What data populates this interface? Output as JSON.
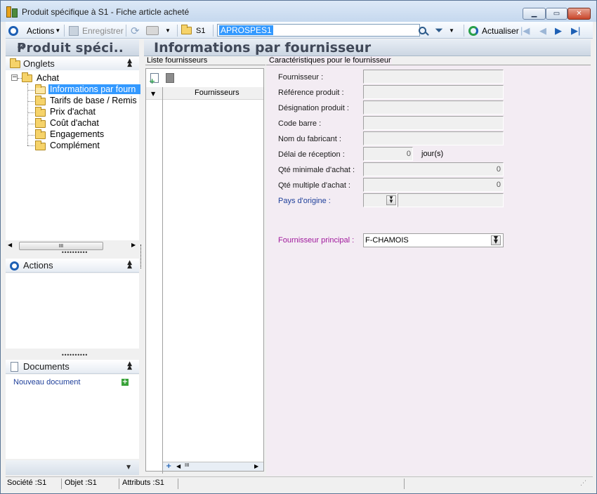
{
  "window": {
    "title": "Produit spécifique à S1 -  Fiche article acheté"
  },
  "toolbar": {
    "actions_label": "Actions",
    "save_label": "Enregistrer",
    "site_label": "S1",
    "record_value": "APROSPES1",
    "refresh_label": "Actualiser"
  },
  "left_panel": {
    "title": "Produit spéci..",
    "collapse_glyph": "«",
    "tabs_header": "Onglets",
    "tree_root": "Achat",
    "tree_items": [
      "Informations par fourn",
      "Tarifs de base / Remis",
      "Prix d'achat",
      "Coût d'achat",
      "Engagements",
      "Complément"
    ],
    "actions_header": "Actions",
    "documents_header": "Documents",
    "new_document_link": "Nouveau document"
  },
  "main": {
    "title": "Informations par fournisseur",
    "supplier_list_label": "Liste fournisseurs",
    "supplier_list_column": "Fournisseurs",
    "characteristics_label": "Caractéristiques pour le fournisseur",
    "fields": {
      "supplier_label": "Fournisseur :",
      "product_ref_label": "Référence produit :",
      "product_desc_label": "Désignation produit :",
      "barcode_label": "Code barre :",
      "manufacturer_label": "Nom du fabricant :",
      "delay_label": "Délai de réception :",
      "delay_value": "0",
      "delay_unit": "jour(s)",
      "min_qty_label": "Qté minimale d'achat :",
      "min_qty_value": "0",
      "multiple_qty_label": "Qté multiple d'achat :",
      "multiple_qty_value": "0",
      "origin_country_label": "Pays d'origine :",
      "main_supplier_label": "Fournisseur principal :",
      "main_supplier_value": "F-CHAMOIS"
    }
  },
  "statusbar": {
    "company": "Société :S1",
    "object": "Objet :S1",
    "attributes": "Attributs :S1"
  },
  "colors": {
    "window_bg": "#f0f0f0",
    "link_blue": "#1e3f9a",
    "main_supplier_magenta": "#a0199c",
    "selection_blue": "#3399ff",
    "title_bar_text": "#404858"
  },
  "icons": {
    "app": "app-icon",
    "actions": "circle-target-icon",
    "save": "save-icon",
    "sync": "sync-icon",
    "print": "printer-icon",
    "folder": "folder-icon",
    "search": "magnifier-icon",
    "filter": "funnel-icon",
    "refresh": "refresh-icon",
    "nav_first": "first-record-icon",
    "nav_prev": "prev-record-icon",
    "nav_next": "next-record-icon",
    "nav_last": "last-record-icon"
  }
}
